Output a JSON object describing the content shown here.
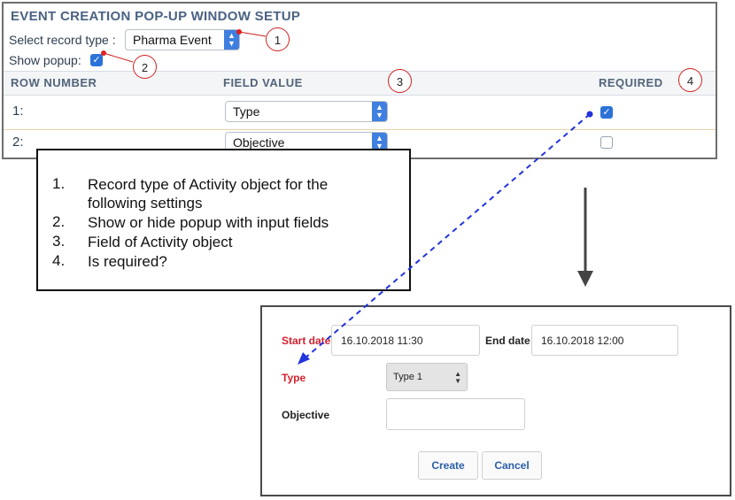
{
  "setup": {
    "title": "EVENT CREATION POP-UP WINDOW SETUP",
    "record_type_label": "Select record type :",
    "record_type_value": "Pharma Event",
    "show_popup_label": "Show popup:",
    "show_popup_checked": true,
    "columns": [
      "ROW NUMBER",
      "FIELD VALUE",
      "REQUIRED"
    ],
    "rows": [
      {
        "number": "1:",
        "field": "Type",
        "required": true
      },
      {
        "number": "2:",
        "field": "Objective",
        "required": false
      }
    ]
  },
  "callouts": [
    "1",
    "2",
    "3",
    "4"
  ],
  "legend": {
    "items": [
      {
        "num": "1.",
        "text": "Record type of Activity object for the following settings"
      },
      {
        "num": "2.",
        "text": "Show or hide popup with input fields"
      },
      {
        "num": "3.",
        "text": "Field of Activity object"
      },
      {
        "num": "4.",
        "text": "Is required?"
      }
    ]
  },
  "popup": {
    "start_label": "Start date",
    "start_value": "16.10.2018 11:30",
    "end_label": "End date",
    "end_value": "16.10.2018 12:00",
    "type_label": "Type",
    "type_value": "Type 1",
    "objective_label": "Objective",
    "objective_value": "",
    "create_label": "Create",
    "cancel_label": "Cancel"
  },
  "colors": {
    "title": "#4a6283",
    "accent_blue": "#2b72d8",
    "callout_red": "#d02020",
    "required_label_red": "#d3202e",
    "connector_blue": "#2233dd"
  },
  "icons": [
    "checkbox-checked-icon",
    "checkbox-unchecked-icon",
    "select-arrows-icon",
    "down-arrow-icon",
    "dashed-connector-arrow-icon"
  ]
}
